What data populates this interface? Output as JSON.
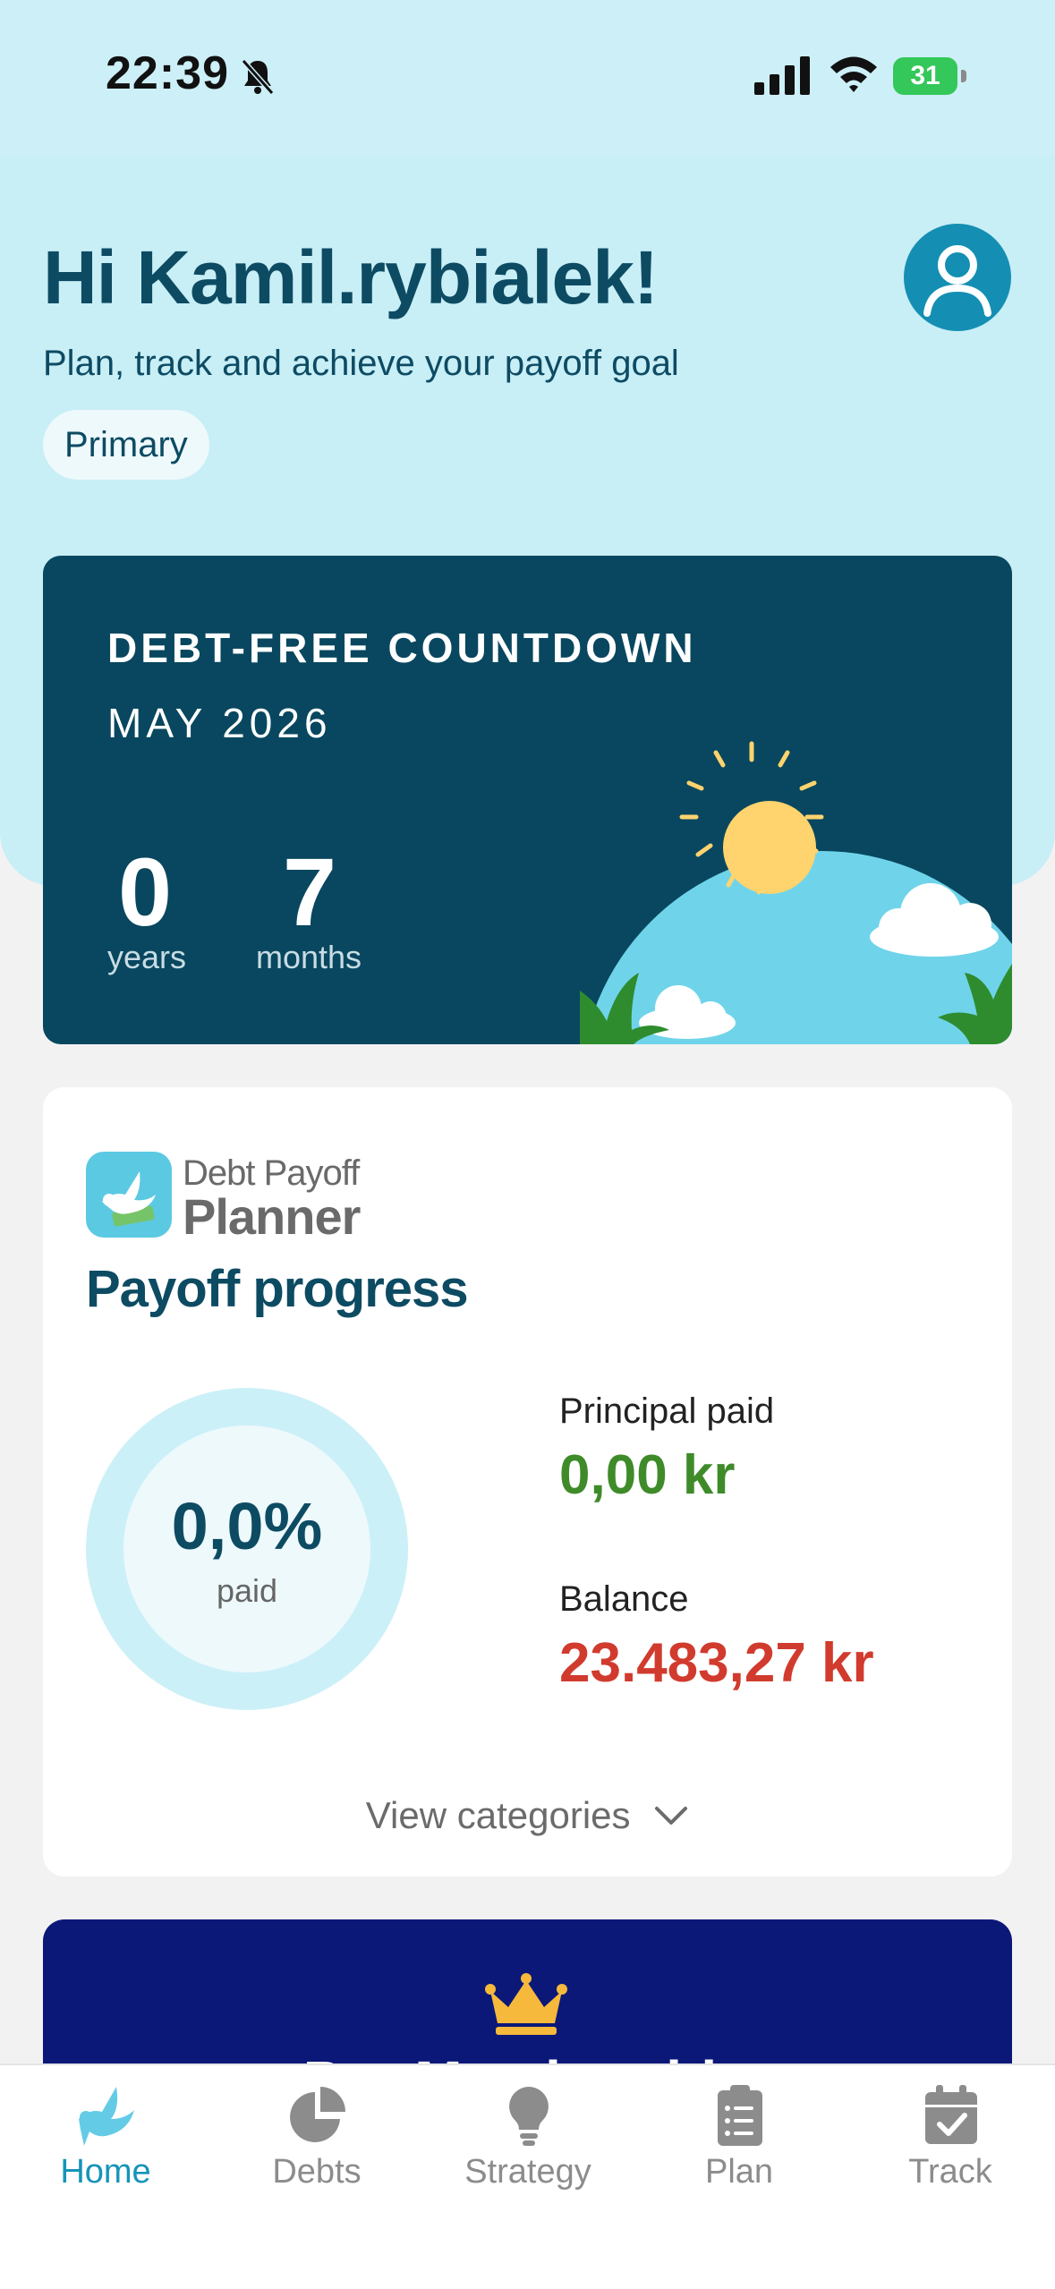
{
  "status_bar": {
    "time": "22:39",
    "battery": "31"
  },
  "header": {
    "greeting": "Hi Kamil.rybialek!",
    "subtitle": "Plan, track and achieve your payoff goal",
    "chip": "Primary"
  },
  "countdown": {
    "title": "DEBT-FREE COUNTDOWN",
    "date": "MAY 2026",
    "years_value": "0",
    "years_label": "years",
    "months_value": "7",
    "months_label": "months"
  },
  "progress": {
    "logo_line1": "Debt Payoff",
    "logo_line2": "Planner",
    "title": "Payoff progress",
    "percent": "0,0%",
    "percent_label": "paid",
    "principal_label": "Principal paid",
    "principal_value": "0,00 kr",
    "balance_label": "Balance",
    "balance_value": "23.483,27 kr",
    "view_categories": "View categories"
  },
  "premium": {
    "title": "Pro Membership"
  },
  "tabs": [
    {
      "label": "Home",
      "icon": "dove-icon",
      "active": true
    },
    {
      "label": "Debts",
      "icon": "pie-chart-icon"
    },
    {
      "label": "Strategy",
      "icon": "lightbulb-icon"
    },
    {
      "label": "Plan",
      "icon": "clipboard-icon"
    },
    {
      "label": "Track",
      "icon": "calendar-check-icon"
    }
  ],
  "colors": {
    "header_bg": "#c8eef6",
    "primary_text": "#0d4b63",
    "countdown_bg": "#08475f",
    "principal": "#3f8b2a",
    "balance": "#d13b2e",
    "premium_bg": "#0b1878",
    "active_tab": "#1594b8"
  }
}
